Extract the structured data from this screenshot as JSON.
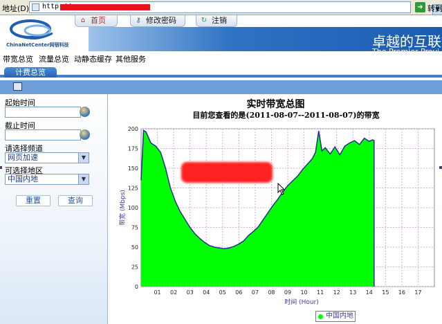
{
  "browser": {
    "address_label": "地址(D)",
    "url_prefix": "http://",
    "go_label": "转到"
  },
  "header": {
    "logo_text": "ChinaNetCenter网宿科技",
    "slogan": "卓越的互联",
    "slogan_en": "The Premier Provi",
    "tabs": [
      {
        "label": "首页",
        "icon": "home-icon"
      },
      {
        "label": "修改密码",
        "icon": "key-icon"
      },
      {
        "label": "注销",
        "icon": "refresh-icon"
      }
    ]
  },
  "menu": {
    "items": [
      "带宽总览",
      "流量总览",
      "动静态缓存",
      "其他服务"
    ]
  },
  "subtab": {
    "label": "计费总览"
  },
  "form": {
    "start_label": "起始时间",
    "start_value": "",
    "end_label": "截止时间",
    "end_value": "",
    "channel_label": "请选择频道",
    "channel_value": "网页加速",
    "region_label": "可选择地区",
    "region_value": "中国内地",
    "reset_label": "重置",
    "query_label": "查询"
  },
  "chart_data": {
    "type": "area",
    "title": "实时带宽总图",
    "subtitle": "目前您查看的是(2011-08-07--2011-08-07)的带宽",
    "xlabel": "时间 (Hour)",
    "ylabel": "带宽 (Mbps)",
    "xlim": [
      0,
      18
    ],
    "ylim": [
      0,
      200
    ],
    "yticks": [
      "0",
      "25",
      "50",
      "75",
      "100",
      "125",
      "150",
      "175",
      "200"
    ],
    "xticks": [
      "01",
      "02",
      "03",
      "04",
      "05",
      "06",
      "07",
      "08",
      "09",
      "10",
      "11",
      "12",
      "13",
      "14",
      "15",
      "16",
      "17"
    ],
    "grid": true,
    "legend_position": "bottom-center",
    "colors": {
      "fill": "#00ff00",
      "line": "#2a2a9a"
    },
    "series": [
      {
        "name": "中国内地",
        "x": [
          0,
          0.15,
          0.3,
          0.6,
          0.9,
          1.2,
          1.5,
          1.8,
          2.1,
          2.4,
          2.7,
          3.0,
          3.3,
          3.6,
          3.9,
          4.2,
          4.5,
          4.8,
          5.1,
          5.4,
          5.7,
          6.0,
          6.3,
          6.6,
          6.9,
          7.2,
          7.5,
          7.8,
          8.1,
          8.4,
          8.7,
          9.0,
          9.3,
          9.6,
          9.9,
          10.2,
          10.5,
          10.7,
          10.9,
          11.1,
          11.3,
          11.6,
          11.9,
          12.2,
          12.5,
          12.8,
          13.1,
          13.4,
          13.7,
          14.0,
          14.2,
          14.3
        ],
        "values": [
          135,
          198,
          196,
          182,
          178,
          170,
          150,
          125,
          108,
          95,
          85,
          75,
          67,
          61,
          56,
          52,
          50,
          49,
          48,
          49,
          51,
          54,
          58,
          65,
          70,
          76,
          85,
          94,
          103,
          111,
          120,
          128,
          134,
          140,
          148,
          155,
          162,
          170,
          197,
          172,
          176,
          168,
          177,
          167,
          178,
          182,
          185,
          180,
          188,
          184,
          186,
          185
        ]
      }
    ]
  }
}
